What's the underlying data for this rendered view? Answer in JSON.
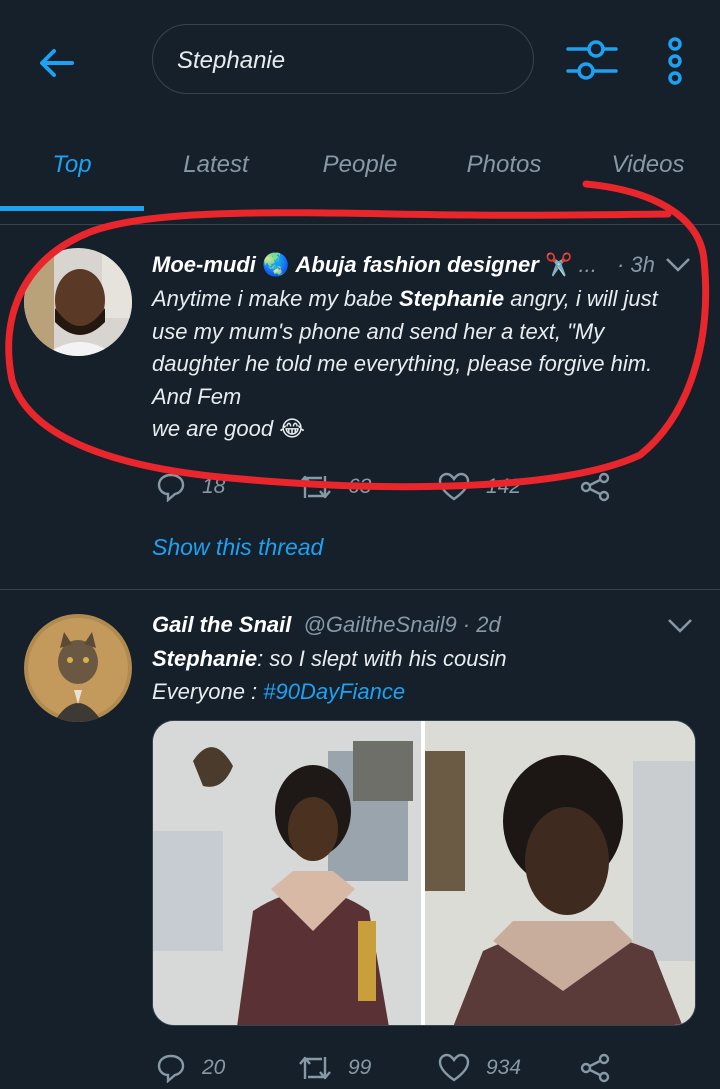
{
  "search": {
    "query": "Stephanie"
  },
  "tabs": [
    {
      "label": "Top",
      "active": true
    },
    {
      "label": "Latest",
      "active": false
    },
    {
      "label": "People",
      "active": false
    },
    {
      "label": "Photos",
      "active": false
    },
    {
      "label": "Videos",
      "active": false
    }
  ],
  "tweets": [
    {
      "name": "Moe-mudi",
      "name_suffix": "Abuja fashion designer",
      "ellipsis": "...",
      "time": "· 3h",
      "lines": [
        {
          "pre": "Anytime i make my babe ",
          "bold": "Stephanie",
          "post": " angry, i will just"
        },
        {
          "text": "use my mum's phone and send her a text, \"My"
        },
        {
          "text": "daughter he told me everything, please forgive him."
        },
        {
          "text": "And Fem"
        },
        {
          "text": "we are good"
        }
      ],
      "emoji": "😂",
      "counts": {
        "reply": "18",
        "retweet": "63",
        "like": "142"
      },
      "show_thread": "Show this thread"
    },
    {
      "name": "Gail the Snail",
      "handle": "@GailtheSnail9 · 2d",
      "lines": [
        {
          "bold": "Stephanie",
          "post": ": so I slept with his cousin"
        },
        {
          "pre": "Everyone : ",
          "hashtag": "#90DayFiance"
        }
      ],
      "counts": {
        "reply": "20",
        "retweet": "99",
        "like": "934"
      }
    }
  ],
  "colors": {
    "accent": "#1da1f2",
    "background": "#15202b",
    "annotation": "#e8262b"
  }
}
